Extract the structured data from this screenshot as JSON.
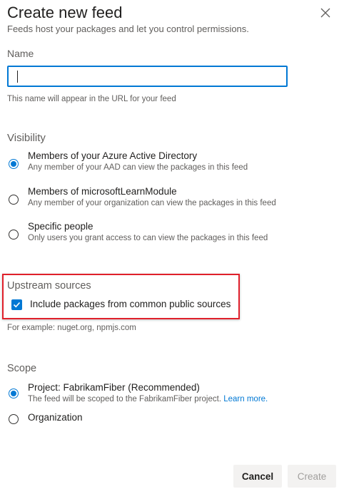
{
  "dialog": {
    "title": "Create new feed",
    "subtitle": "Feeds host your packages and let you control permissions."
  },
  "name": {
    "label": "Name",
    "value": "",
    "placeholder": "",
    "help": "This name will appear in the URL for your feed"
  },
  "visibility": {
    "label": "Visibility",
    "options": [
      {
        "label": "Members of your Azure Active Directory",
        "description": "Any member of your AAD can view the packages in this feed",
        "selected": true
      },
      {
        "label": "Members of microsoftLearnModule",
        "description": "Any member of your organization can view the packages in this feed",
        "selected": false
      },
      {
        "label": "Specific people",
        "description": "Only users you grant access to can view the packages in this feed",
        "selected": false
      }
    ]
  },
  "upstream": {
    "label": "Upstream sources",
    "checkbox_label": "Include packages from common public sources",
    "checked": true,
    "help": "For example: nuget.org, npmjs.com"
  },
  "scope": {
    "label": "Scope",
    "options": [
      {
        "label": "Project: FabrikamFiber (Recommended)",
        "description": "The feed will be scoped to the FabrikamFiber project.",
        "link": "Learn more.",
        "selected": true
      },
      {
        "label": "Organization",
        "selected": false
      }
    ]
  },
  "footer": {
    "cancel_label": "Cancel",
    "create_label": "Create"
  },
  "colors": {
    "accent": "#0078d4",
    "highlight_border": "#e0202b",
    "secondary_text": "#605e5c"
  }
}
